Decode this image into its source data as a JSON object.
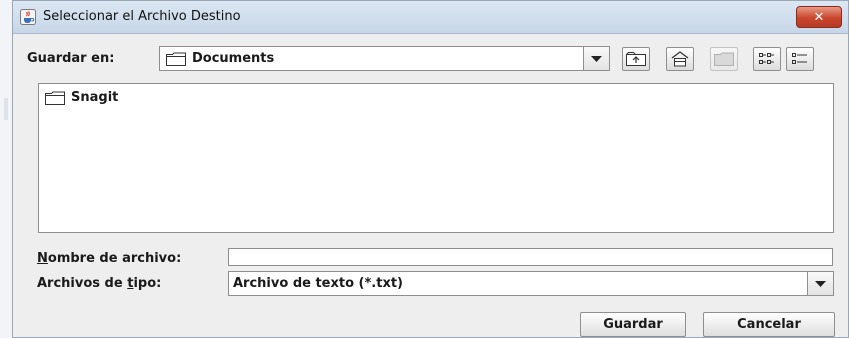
{
  "window": {
    "title": "Seleccionar el Archivo Destino",
    "close_glyph": "✕",
    "title_icon": "java-cup-icon"
  },
  "save_in": {
    "label": "Guardar en:",
    "value": "Documents"
  },
  "toolbar": {
    "icons": [
      "up-folder-icon",
      "home-folder-icon",
      "new-folder-icon",
      "list-view-icon",
      "details-view-icon"
    ]
  },
  "file_list": {
    "items": [
      {
        "name": "Snagit",
        "icon": "folder-icon"
      }
    ]
  },
  "filename": {
    "label_first": "N",
    "label_rest": "ombre de archivo:",
    "value": ""
  },
  "filetype": {
    "label_before": "Archivos de ",
    "label_mnemonic": "t",
    "label_after": "ipo:",
    "value": "Archivo de texto (*.txt)"
  },
  "buttons": {
    "save": "Guardar",
    "cancel": "Cancelar"
  },
  "colors": {
    "titlebar": "#c7d6e8",
    "close": "#c9462e",
    "window_bg": "#eeeeee"
  }
}
